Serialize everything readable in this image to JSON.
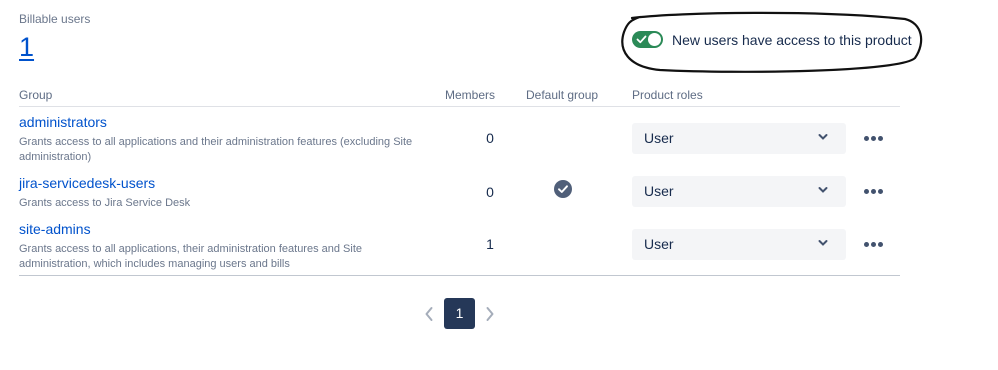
{
  "billable": {
    "label": "Billable users",
    "count": "1"
  },
  "access_toggle": {
    "label": "New users have access to this product",
    "enabled": true
  },
  "table": {
    "headers": {
      "group": "Group",
      "members": "Members",
      "default_group": "Default group",
      "product_roles": "Product roles"
    },
    "rows": [
      {
        "name": "administrators",
        "description": "Grants access to all applications and their administration features (excluding Site administration)",
        "members": "0",
        "default_group": false,
        "role": "User"
      },
      {
        "name": "jira-servicedesk-users",
        "description": "Grants access to Jira Service Desk",
        "members": "0",
        "default_group": true,
        "role": "User"
      },
      {
        "name": "site-admins",
        "description": "Grants access to all applications, their administration features and Site administration, which includes managing users and bills",
        "members": "1",
        "default_group": false,
        "role": "User"
      }
    ]
  },
  "pagination": {
    "current_page": "1"
  },
  "colors": {
    "link": "#0052cc",
    "toggle_on": "#2b8a57",
    "page_active": "#253858"
  }
}
